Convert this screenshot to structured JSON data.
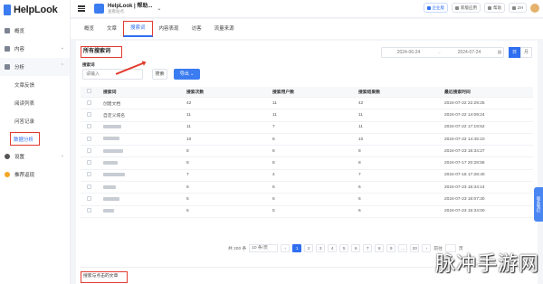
{
  "app": {
    "logo_text": "HelpLook"
  },
  "sidebar": {
    "items": [
      {
        "label": "概览",
        "icon": "home-icon"
      },
      {
        "label": "内容",
        "icon": "document-icon",
        "chevron": "⌄"
      },
      {
        "label": "分析",
        "icon": "chart-icon",
        "chevron": "⌃"
      }
    ],
    "sub_items": [
      "文章反馈",
      "阅读列表",
      "问答记录",
      "数据分析"
    ],
    "bottom_items": [
      {
        "label": "设置",
        "icon": "gear-icon",
        "chevron": "⌄"
      },
      {
        "label": "推荐返现",
        "icon": "gift-icon"
      }
    ]
  },
  "header": {
    "site_title": "HelpLook | 帮助...",
    "site_subtitle": "查看站点",
    "chevron": "⌄",
    "buttons": [
      {
        "label": "企业版",
        "style": "primary"
      },
      {
        "label": "新版应用"
      },
      {
        "label": "帮助"
      },
      {
        "label": "ZH"
      }
    ]
  },
  "tabs": [
    "概览",
    "文章",
    "搜索词",
    "内容表现",
    "访客",
    "流量来源"
  ],
  "active_tab": "搜索词",
  "card": {
    "title": "所有搜索词",
    "date_from": "2024-06-24",
    "date_to": "2024-07-24",
    "date_arrow": "→",
    "view_buttons": [
      "日",
      "月"
    ],
    "keyword_label": "搜索词",
    "keyword_placeholder": "请输入",
    "search_label": "搜索",
    "export_label": "导出 ⌄"
  },
  "table": {
    "columns": [
      "搜索词",
      "搜索次数",
      "搜索用户数",
      "搜索结果数",
      "最近搜索时间"
    ],
    "rows": [
      [
        "创建文档",
        "42",
        "11",
        "42",
        "2024-07-22 22:29:25"
      ],
      [
        "自定义域名",
        "11",
        "11",
        "11",
        "2024-07-22 14:09:24"
      ],
      [
        "",
        "11",
        "7",
        "11",
        "2024-07-22 17:19:52"
      ],
      [
        "",
        "10",
        "6",
        "10",
        "2024-07-22 14:45:10"
      ],
      [
        "",
        "8",
        "8",
        "8",
        "2024-07-23 16:34:27"
      ],
      [
        "",
        "8",
        "8",
        "8",
        "2024-07-17 20:28:56"
      ],
      [
        "",
        "7",
        "4",
        "7",
        "2024-07-18 17:28:40"
      ],
      [
        "",
        "6",
        "6",
        "6",
        "2024-07-23 15:34:14"
      ],
      [
        "",
        "6",
        "6",
        "6",
        "2024-07-23 16:07:30"
      ],
      [
        "",
        "6",
        "5",
        "6",
        "2024-07-23 15:34:00"
      ]
    ]
  },
  "pagination": {
    "total": "共 200 条",
    "page_size": "10 条/页",
    "prev": "‹",
    "pages": [
      "1",
      "2",
      "3",
      "4",
      "5",
      "6",
      "7",
      "8",
      "9",
      "…",
      "20"
    ],
    "active_page": "1",
    "next": "›",
    "goto_label": "前往",
    "goto_suffix": "页"
  },
  "footer_section": {
    "title": "搜索与点击的文章"
  },
  "floating_tab": {
    "label": "联系我们"
  },
  "watermark": "脉冲手游网",
  "colors": {
    "accent": "#2f6ff0",
    "highlight_box": "#e33b2f",
    "export_button": "#3b7cf0"
  }
}
